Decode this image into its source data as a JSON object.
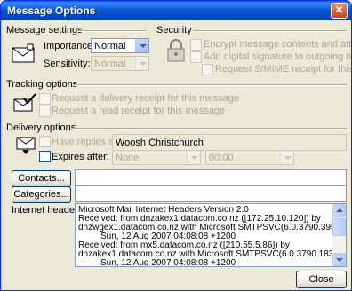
{
  "window": {
    "title": "Message Options",
    "close_glyph": "✕"
  },
  "message_settings": {
    "title": "Message settings",
    "importance_label": "Importance:",
    "importance_value": "Normal",
    "sensitivity_label": "Sensitivity:",
    "sensitivity_value": "Normal"
  },
  "security": {
    "title": "Security",
    "encrypt_label": "Encrypt message contents and attachments",
    "signature_label": "Add digital signature to outgoing message",
    "smime_label": "Request S/MIME receipt for this message"
  },
  "tracking": {
    "title": "Tracking options",
    "delivery_receipt_label": "Request a delivery receipt for this message",
    "read_receipt_label": "Request a read receipt for this message"
  },
  "delivery": {
    "title": "Delivery options",
    "replies_label": "Have replies sent to:",
    "replies_value": "Woosh Christchurch",
    "expires_label": "Expires after:",
    "expires_date": "None",
    "expires_time": "00:00"
  },
  "contacts_button": "Contacts...",
  "categories_button": "Categories...",
  "headers_label": "Internet headers:",
  "headers_lines": [
    "Microsoft Mail Internet Headers Version 2.0",
    "Received: from dnzakex1.datacom.co.nz ([172.25.10.120]) by",
    "dnzwgex1.datacom.co.nz with Microsoft SMTPSVC(6.0.3790.3959);",
    "         Sun, 12 Aug 2007 04:08:08 +1200",
    "Received: from mx5.datacom.co.nz ([210.55.5.86]) by",
    "dnzakex1.datacom.co.nz with Microsoft SMTPSVC(6.0.3790.1830);",
    "         Sun, 12 Aug 2007 04:08:08 +1200"
  ],
  "close_button": "Close",
  "icons": {
    "message": "envelope-icon",
    "security": "lock-icon",
    "tracking": "checkmark-envelope-icon",
    "delivery": "delivery-envelope-icon",
    "close": "close-icon"
  }
}
